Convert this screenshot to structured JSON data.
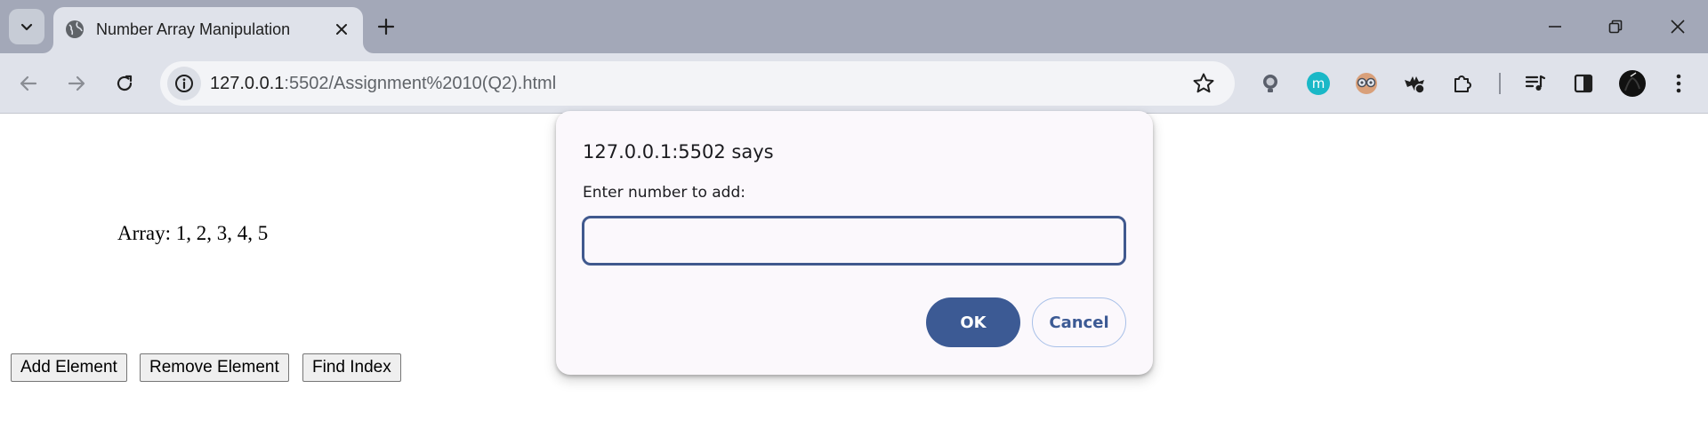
{
  "browser": {
    "tab": {
      "title": "Number Array Manipulation"
    },
    "address_bar": {
      "url_host": "127.0.0.1",
      "url_rest": ":5502/Assignment%2010(Q2).html"
    }
  },
  "page": {
    "array_label": "Array: 1, 2, 3, 4, 5",
    "buttons": {
      "add": "Add Element",
      "remove": "Remove Element",
      "find": "Find Index"
    }
  },
  "dialog": {
    "title": "127.0.0.1:5502 says",
    "message": "Enter number to add:",
    "input_value": "",
    "ok_label": "OK",
    "cancel_label": "Cancel"
  },
  "colors": {
    "tabstrip": "#a3a8b8",
    "toolbar": "#dfe2ea",
    "dialog_accent": "#3c5a94",
    "dialog_bg": "#fbf8fc"
  },
  "icons": {
    "tab_search": "chevron-down-icon",
    "favicon": "globe-icon",
    "tab_close": "close-icon",
    "new_tab": "plus-icon",
    "minimize": "minimize-icon",
    "restore": "restore-icon",
    "close_window": "close-icon",
    "back": "arrow-left-icon",
    "forward": "arrow-right-icon",
    "reload": "reload-icon",
    "site_info": "info-icon",
    "bookmark": "star-icon",
    "extensions": [
      "lightbulb-icon",
      "m-extension-icon",
      "glasses-extension-icon",
      "bat-extension-icon",
      "puzzle-icon"
    ],
    "media": "media-control-icon",
    "side_panel": "side-panel-icon",
    "profile": "avatar-icon",
    "menu": "kebab-menu-icon"
  }
}
